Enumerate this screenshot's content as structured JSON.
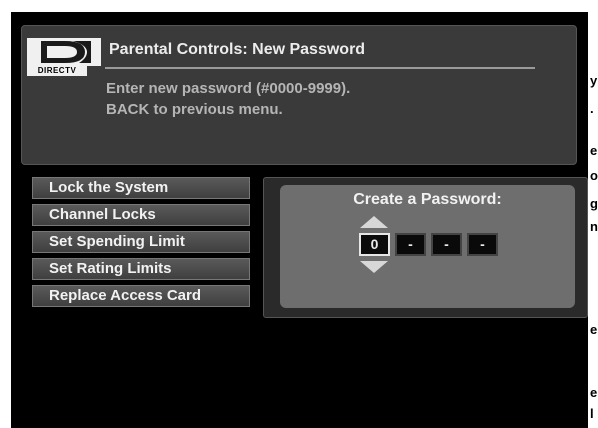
{
  "header": {
    "brand": "DIRECTV",
    "title": "Parental Controls: New Password",
    "line1": "Enter new password (#0000-9999).",
    "line2": "BACK to previous menu."
  },
  "menu": {
    "items": [
      {
        "label": "Lock  the System"
      },
      {
        "label": "Channel Locks"
      },
      {
        "label": "Set Spending Limit"
      },
      {
        "label": "Set Rating Limits"
      },
      {
        "label": "Replace Access Card"
      }
    ]
  },
  "password": {
    "label": "Create a Password:",
    "digits": [
      "0",
      "-",
      "-",
      "-"
    ]
  },
  "edge_text": [
    "y",
    ".",
    "e",
    "o",
    "g",
    "n",
    "e",
    "e",
    "l"
  ]
}
